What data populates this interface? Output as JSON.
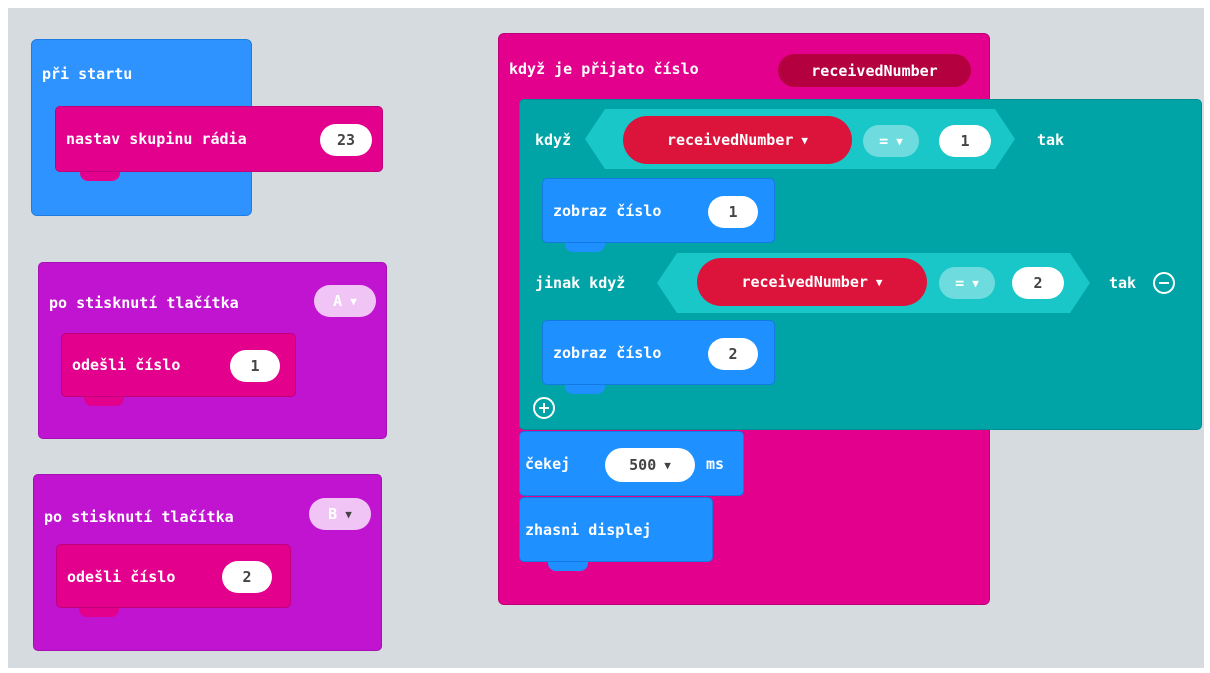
{
  "colors": {
    "event_blue": "#2e93ff",
    "radio_pink": "#e3008c",
    "input_purple": "#c014d0",
    "logic_teal": "#00a4a6",
    "basic_blue": "#1e90ff",
    "variable_red": "#dc143c",
    "canvas": "#edf0f3"
  },
  "on_start": {
    "label": "při startu",
    "set_group": {
      "label": "nastav skupinu rádia",
      "value": "23"
    }
  },
  "button_a": {
    "label": "po stisknutí tlačítka",
    "button": "A",
    "send": {
      "label": "odešli číslo",
      "value": "1"
    }
  },
  "button_b": {
    "label": "po stisknutí tlačítka",
    "button": "B",
    "send": {
      "label": "odešli číslo",
      "value": "2"
    }
  },
  "on_received": {
    "label": "když je přijato číslo",
    "param": "receivedNumber",
    "if_block": {
      "if_label": "když",
      "cond1": {
        "var": "receivedNumber",
        "op": "=",
        "value": "1"
      },
      "then1": "tak",
      "show1": {
        "label": "zobraz číslo",
        "value": "1"
      },
      "elseif_label": "jinak když",
      "cond2": {
        "var": "receivedNumber",
        "op": "=",
        "value": "2"
      },
      "then2": "tak",
      "show2": {
        "label": "zobraz číslo",
        "value": "2"
      },
      "remove_icon": "minus-circle-icon",
      "add_icon": "plus-circle-icon"
    },
    "pause": {
      "label": "čekej",
      "value": "500",
      "unit": "ms"
    },
    "clear": {
      "label": "zhasni displej"
    }
  }
}
